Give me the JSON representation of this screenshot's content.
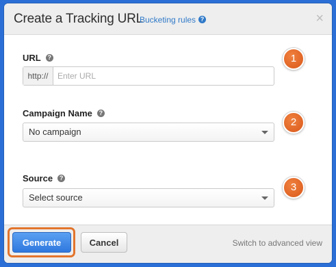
{
  "dialog": {
    "title": "Create a Tracking URL",
    "bucketing_link": "Bucketing rules",
    "help_glyph": "?",
    "close_glyph": "×"
  },
  "url_field": {
    "label": "URL",
    "prefix": "http://",
    "placeholder": "Enter URL",
    "value": ""
  },
  "campaign_field": {
    "label": "Campaign Name",
    "selected": "No campaign"
  },
  "source_field": {
    "label": "Source",
    "selected": "Select source"
  },
  "step_badges": [
    "1",
    "2",
    "3"
  ],
  "footer": {
    "generate_label": "Generate",
    "cancel_label": "Cancel",
    "advanced_link": "Switch to advanced view"
  },
  "colors": {
    "accent": "#2f78de",
    "highlight": "#e2742c",
    "link": "#2f79c8"
  },
  "icons": {
    "help": "help-icon",
    "close": "close-icon",
    "dropdown": "chevron-down-icon"
  }
}
